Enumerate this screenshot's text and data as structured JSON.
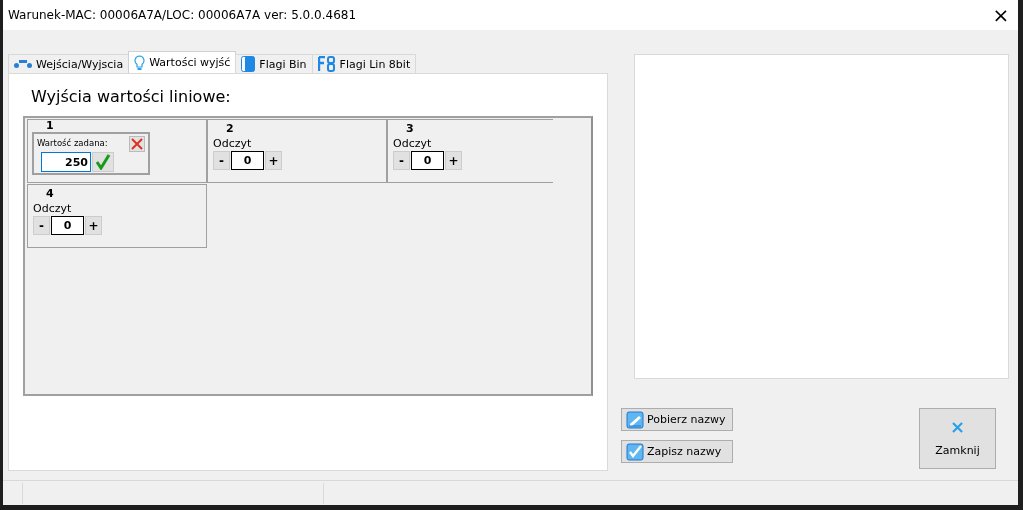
{
  "window": {
    "title": "Warunek-MAC: 00006A7A/LOC: 00006A7A ver: 5.0.0.4681",
    "close": "×"
  },
  "tabs": [
    {
      "label": "Wejścia/Wyjscia",
      "selected": false
    },
    {
      "label": "Wartości wyjść",
      "selected": true
    },
    {
      "label": "Flagi Bin",
      "selected": false
    },
    {
      "label": "Flagi Lin 8bit",
      "selected": false
    }
  ],
  "heading": "Wyjścia wartości liniowe:",
  "outputs": [
    {
      "kind": "editor",
      "number": "1",
      "caption": "Wartość zadana:",
      "value": "250"
    },
    {
      "kind": "reading",
      "number": "2",
      "caption": "Odczyt",
      "minus": "-",
      "value": "0",
      "plus": "+"
    },
    {
      "kind": "reading",
      "number": "3",
      "caption": "Odczyt",
      "minus": "-",
      "value": "0",
      "plus": "+"
    },
    {
      "kind": "reading",
      "number": "4",
      "caption": "Odczyt",
      "minus": "-",
      "value": "0",
      "plus": "+"
    }
  ],
  "buttons": [
    {
      "label": "Pobierz nazwy"
    },
    {
      "label": "Zapisz nazwy"
    }
  ],
  "close_button": {
    "icon": "×",
    "label": "Zamknij"
  }
}
